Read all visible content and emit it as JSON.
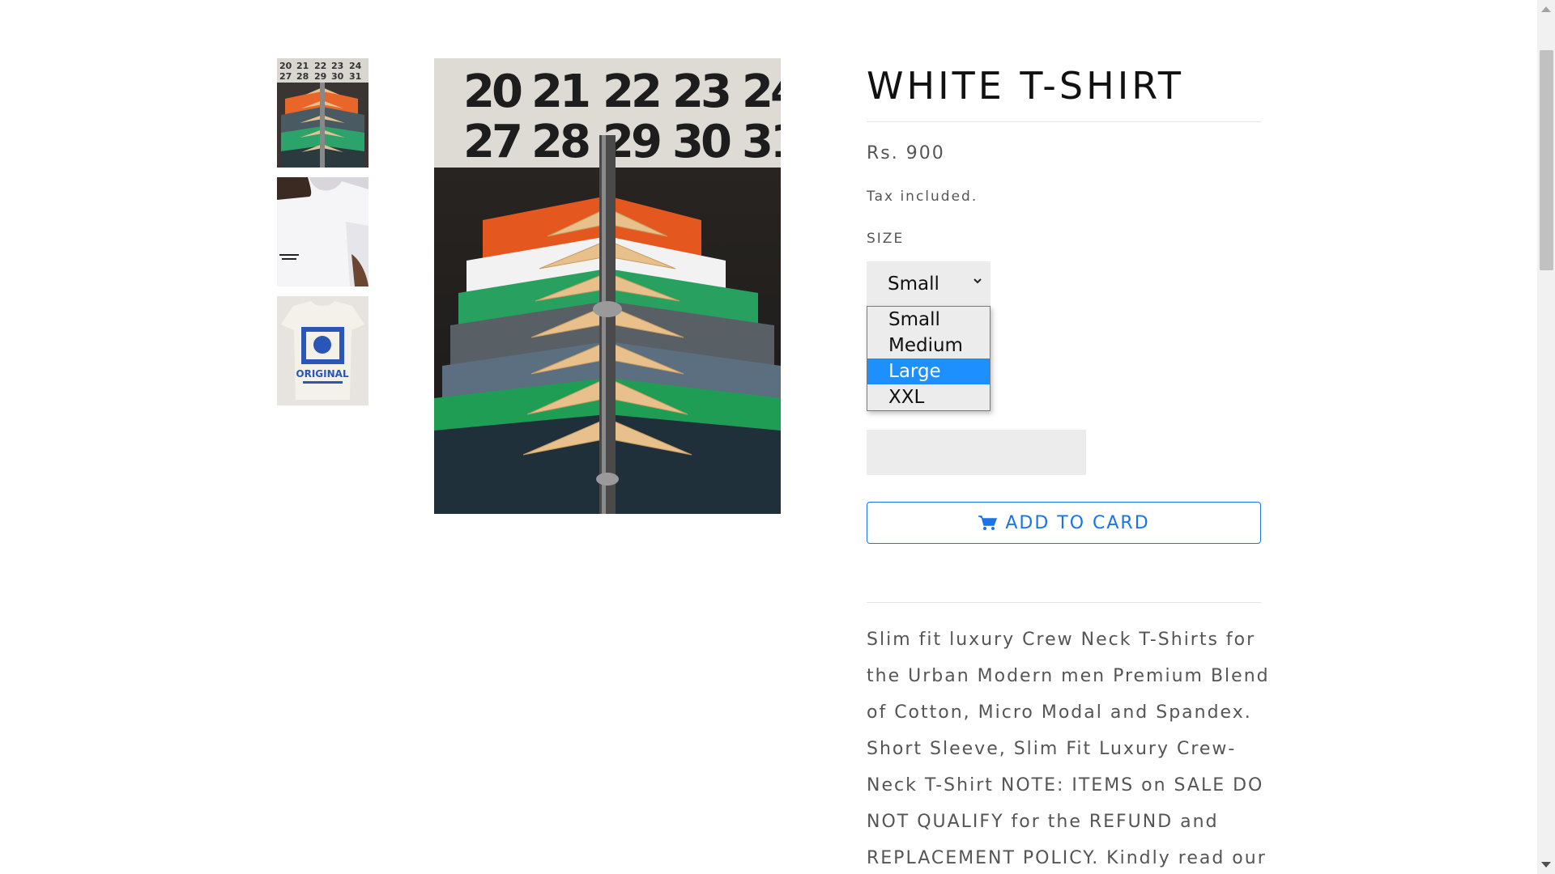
{
  "product": {
    "title": "WHITE T-SHIRT",
    "price": "Rs. 900",
    "tax_note": "Tax included.",
    "size_label": "SIZE",
    "size_selected": "Small",
    "size_options": [
      "Small",
      "Medium",
      "Large",
      "XXL"
    ],
    "size_highlighted": "Large",
    "add_button_label": "ADD TO CARD",
    "description": "Slim fit luxury Crew Neck T-Shirts for the Urban Modern men Premium Blend of Cotton, Micro Modal and Spandex. Short Sleeve, Slim Fit Luxury Crew-Neck T-Shirt NOTE: ITEMS on SALE DO NOT QUALIFY for the REFUND and REPLACEMENT POLICY. Kindly read our"
  },
  "images": {
    "calendar_row_1": [
      "20",
      "21",
      "22",
      "23",
      "24"
    ],
    "calendar_row_2": [
      "27",
      "28",
      "29",
      "30",
      "31"
    ],
    "thumb_3_text": "ORIGINAL",
    "thumbnails": [
      "hanging-shirts-thumbnail",
      "white-tshirt-model-thumbnail",
      "original-print-tshirt-thumbnail"
    ]
  },
  "icons": {
    "cart": "cart-icon",
    "chevron": "chevron-down-icon"
  },
  "colors": {
    "accent": "#1a73e8",
    "highlight": "#1e8fff",
    "text_muted": "#555555",
    "field_bg": "#ececec"
  }
}
